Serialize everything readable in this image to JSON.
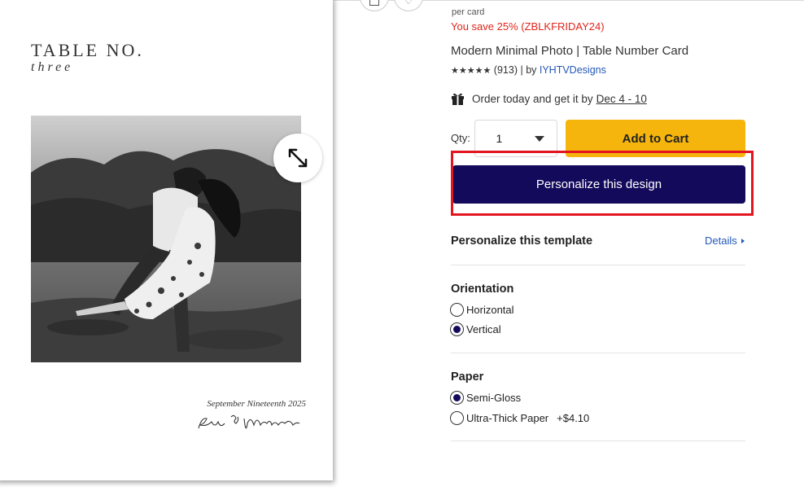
{
  "card": {
    "title": "TABLE NO.",
    "subtitle": "three",
    "date": "September Nineteenth 2025",
    "signature": "Eva & Morris"
  },
  "pricing": {
    "per_card": "per card",
    "savings": "You save 25% (ZBLKFRIDAY24)"
  },
  "product": {
    "title": "Modern Minimal Photo | Table Number Card",
    "stars": "★★★★★",
    "review_count": "(913)",
    "by_label": "| by",
    "seller": "IYHTVDesigns"
  },
  "delivery": {
    "text": "Order today and get it by",
    "date": "Dec 4 - 10"
  },
  "purchase": {
    "qty_label": "Qty:",
    "qty_value": "1",
    "add_to_cart": "Add to Cart",
    "personalize": "Personalize this design"
  },
  "template": {
    "title": "Personalize this template",
    "details": "Details"
  },
  "orientation": {
    "title": "Orientation",
    "options": [
      {
        "label": "Horizontal",
        "selected": false
      },
      {
        "label": "Vertical",
        "selected": true
      }
    ]
  },
  "paper": {
    "title": "Paper",
    "options": [
      {
        "label": "Semi-Gloss",
        "selected": true
      },
      {
        "label": "Ultra-Thick Paper",
        "price": "+$4.10",
        "selected": false
      }
    ]
  },
  "colors": {
    "accent_navy": "#140a5c",
    "cart_yellow": "#f5b50d",
    "sale_red": "#e1251b",
    "link_blue": "#2357b8",
    "highlight_red": "#e3151f"
  }
}
